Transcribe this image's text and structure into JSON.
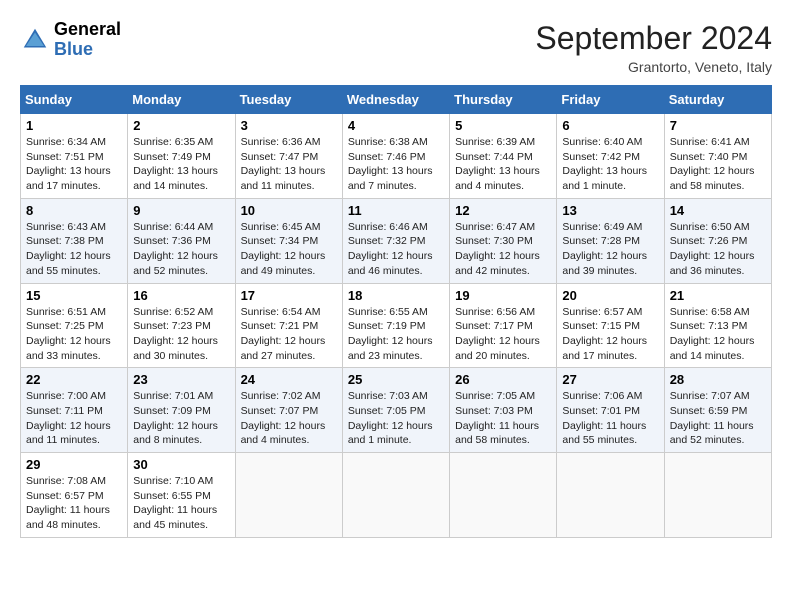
{
  "header": {
    "logo_general": "General",
    "logo_blue": "Blue",
    "month_title": "September 2024",
    "location": "Grantorto, Veneto, Italy"
  },
  "days_of_week": [
    "Sunday",
    "Monday",
    "Tuesday",
    "Wednesday",
    "Thursday",
    "Friday",
    "Saturday"
  ],
  "weeks": [
    [
      {
        "day": 1,
        "sunrise": "6:34 AM",
        "sunset": "7:51 PM",
        "daylight": "13 hours and 17 minutes."
      },
      {
        "day": 2,
        "sunrise": "6:35 AM",
        "sunset": "7:49 PM",
        "daylight": "13 hours and 14 minutes."
      },
      {
        "day": 3,
        "sunrise": "6:36 AM",
        "sunset": "7:47 PM",
        "daylight": "13 hours and 11 minutes."
      },
      {
        "day": 4,
        "sunrise": "6:38 AM",
        "sunset": "7:46 PM",
        "daylight": "13 hours and 7 minutes."
      },
      {
        "day": 5,
        "sunrise": "6:39 AM",
        "sunset": "7:44 PM",
        "daylight": "13 hours and 4 minutes."
      },
      {
        "day": 6,
        "sunrise": "6:40 AM",
        "sunset": "7:42 PM",
        "daylight": "13 hours and 1 minute."
      },
      {
        "day": 7,
        "sunrise": "6:41 AM",
        "sunset": "7:40 PM",
        "daylight": "12 hours and 58 minutes."
      }
    ],
    [
      {
        "day": 8,
        "sunrise": "6:43 AM",
        "sunset": "7:38 PM",
        "daylight": "12 hours and 55 minutes."
      },
      {
        "day": 9,
        "sunrise": "6:44 AM",
        "sunset": "7:36 PM",
        "daylight": "12 hours and 52 minutes."
      },
      {
        "day": 10,
        "sunrise": "6:45 AM",
        "sunset": "7:34 PM",
        "daylight": "12 hours and 49 minutes."
      },
      {
        "day": 11,
        "sunrise": "6:46 AM",
        "sunset": "7:32 PM",
        "daylight": "12 hours and 46 minutes."
      },
      {
        "day": 12,
        "sunrise": "6:47 AM",
        "sunset": "7:30 PM",
        "daylight": "12 hours and 42 minutes."
      },
      {
        "day": 13,
        "sunrise": "6:49 AM",
        "sunset": "7:28 PM",
        "daylight": "12 hours and 39 minutes."
      },
      {
        "day": 14,
        "sunrise": "6:50 AM",
        "sunset": "7:26 PM",
        "daylight": "12 hours and 36 minutes."
      }
    ],
    [
      {
        "day": 15,
        "sunrise": "6:51 AM",
        "sunset": "7:25 PM",
        "daylight": "12 hours and 33 minutes."
      },
      {
        "day": 16,
        "sunrise": "6:52 AM",
        "sunset": "7:23 PM",
        "daylight": "12 hours and 30 minutes."
      },
      {
        "day": 17,
        "sunrise": "6:54 AM",
        "sunset": "7:21 PM",
        "daylight": "12 hours and 27 minutes."
      },
      {
        "day": 18,
        "sunrise": "6:55 AM",
        "sunset": "7:19 PM",
        "daylight": "12 hours and 23 minutes."
      },
      {
        "day": 19,
        "sunrise": "6:56 AM",
        "sunset": "7:17 PM",
        "daylight": "12 hours and 20 minutes."
      },
      {
        "day": 20,
        "sunrise": "6:57 AM",
        "sunset": "7:15 PM",
        "daylight": "12 hours and 17 minutes."
      },
      {
        "day": 21,
        "sunrise": "6:58 AM",
        "sunset": "7:13 PM",
        "daylight": "12 hours and 14 minutes."
      }
    ],
    [
      {
        "day": 22,
        "sunrise": "7:00 AM",
        "sunset": "7:11 PM",
        "daylight": "12 hours and 11 minutes."
      },
      {
        "day": 23,
        "sunrise": "7:01 AM",
        "sunset": "7:09 PM",
        "daylight": "12 hours and 8 minutes."
      },
      {
        "day": 24,
        "sunrise": "7:02 AM",
        "sunset": "7:07 PM",
        "daylight": "12 hours and 4 minutes."
      },
      {
        "day": 25,
        "sunrise": "7:03 AM",
        "sunset": "7:05 PM",
        "daylight": "12 hours and 1 minute."
      },
      {
        "day": 26,
        "sunrise": "7:05 AM",
        "sunset": "7:03 PM",
        "daylight": "11 hours and 58 minutes."
      },
      {
        "day": 27,
        "sunrise": "7:06 AM",
        "sunset": "7:01 PM",
        "daylight": "11 hours and 55 minutes."
      },
      {
        "day": 28,
        "sunrise": "7:07 AM",
        "sunset": "6:59 PM",
        "daylight": "11 hours and 52 minutes."
      }
    ],
    [
      {
        "day": 29,
        "sunrise": "7:08 AM",
        "sunset": "6:57 PM",
        "daylight": "11 hours and 48 minutes."
      },
      {
        "day": 30,
        "sunrise": "7:10 AM",
        "sunset": "6:55 PM",
        "daylight": "11 hours and 45 minutes."
      },
      null,
      null,
      null,
      null,
      null
    ]
  ]
}
